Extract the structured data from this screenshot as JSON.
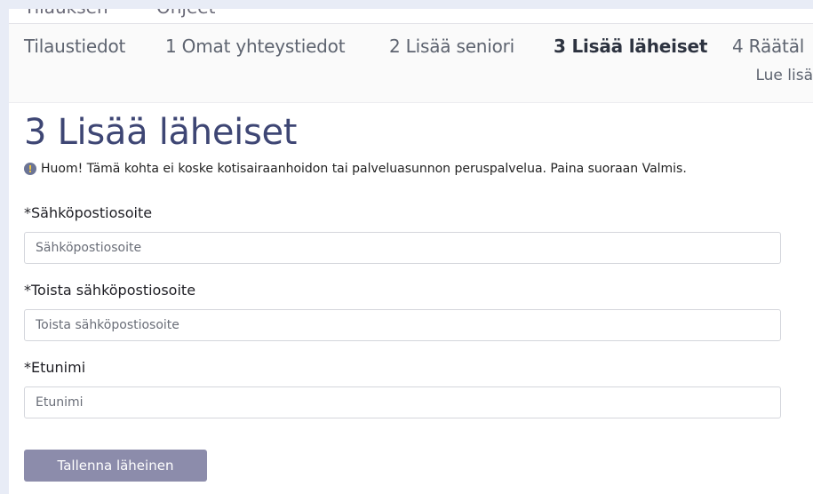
{
  "topnav": {
    "items": [
      "Tilauksen",
      "Ohjeet"
    ]
  },
  "steps": {
    "items": [
      {
        "label": "Tilaustiedot"
      },
      {
        "label": "1 Omat yhteystiedot"
      },
      {
        "label": "2 Lisää seniori"
      },
      {
        "label": "3 Lisää läheiset"
      },
      {
        "label": "4 Räätäl"
      }
    ],
    "active_index": 3,
    "read_more": "Lue lisä"
  },
  "main": {
    "title": "3 Lisää läheiset",
    "notice_icon": "!",
    "notice": "Huom! Tämä kohta ei koske kotisairaanhoidon tai palveluasunnon peruspalvelua. Paina suoraan Valmis.",
    "fields": [
      {
        "label": "*Sähköpostiosoite",
        "placeholder": "Sähköpostiosoite",
        "value": ""
      },
      {
        "label": "*Toista sähköpostiosoite",
        "placeholder": "Toista sähköpostiosoite",
        "value": ""
      },
      {
        "label": "*Etunimi",
        "placeholder": "Etunimi",
        "value": ""
      }
    ],
    "save_label": "Tallenna läheinen"
  },
  "colors": {
    "heading": "#3e4674",
    "button": "#8c8cab",
    "background": "#e8ecf6"
  }
}
